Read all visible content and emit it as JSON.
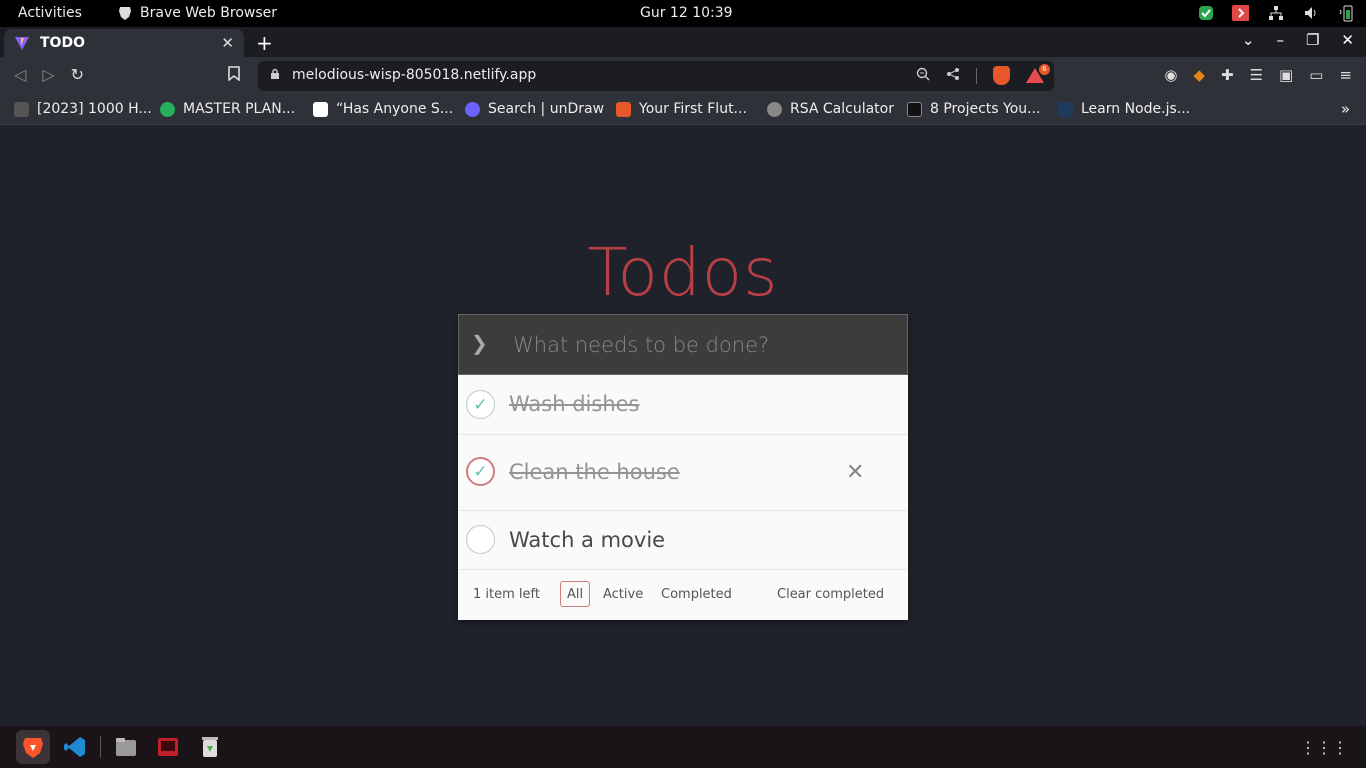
{
  "topbar": {
    "activities": "Activities",
    "app_name": "Brave Web Browser",
    "clock": "Gur 12  10:39"
  },
  "browser": {
    "tab_title": "TODO",
    "url": "melodious-wisp-805018.netlify.app",
    "rewards_badge": "6",
    "bookmarks": [
      {
        "label": "[2023] 1000 H...",
        "color": "#555555"
      },
      {
        "label": "MASTER PLAN...",
        "color": "#27ae60"
      },
      {
        "label": "“Has Anyone S...",
        "color": "#ffffff"
      },
      {
        "label": "Search | unDraw",
        "color": "#6c63ff"
      },
      {
        "label": "Your First Flut...",
        "color": "#e8572a"
      },
      {
        "label": "RSA Calculator",
        "color": "#888888"
      },
      {
        "label": "8 Projects You...",
        "color": "#111111"
      },
      {
        "label": "Learn Node.js...",
        "color": "#1f3a5a"
      }
    ]
  },
  "app": {
    "title": "Todos",
    "new_todo_placeholder": "What needs to be done?",
    "todos": [
      {
        "label": "Wash dishes",
        "completed": true
      },
      {
        "label": "Clean the house",
        "completed": true
      },
      {
        "label": "Watch a movie",
        "completed": false
      }
    ],
    "footer": {
      "count": "1 item left",
      "filters": [
        "All",
        "Active",
        "Completed"
      ],
      "selected_filter": "All",
      "clear_completed": "Clear completed"
    }
  },
  "colors": {
    "accent": "#b83f45",
    "check": "#5dc2af",
    "page_bg": "#1f222b"
  }
}
